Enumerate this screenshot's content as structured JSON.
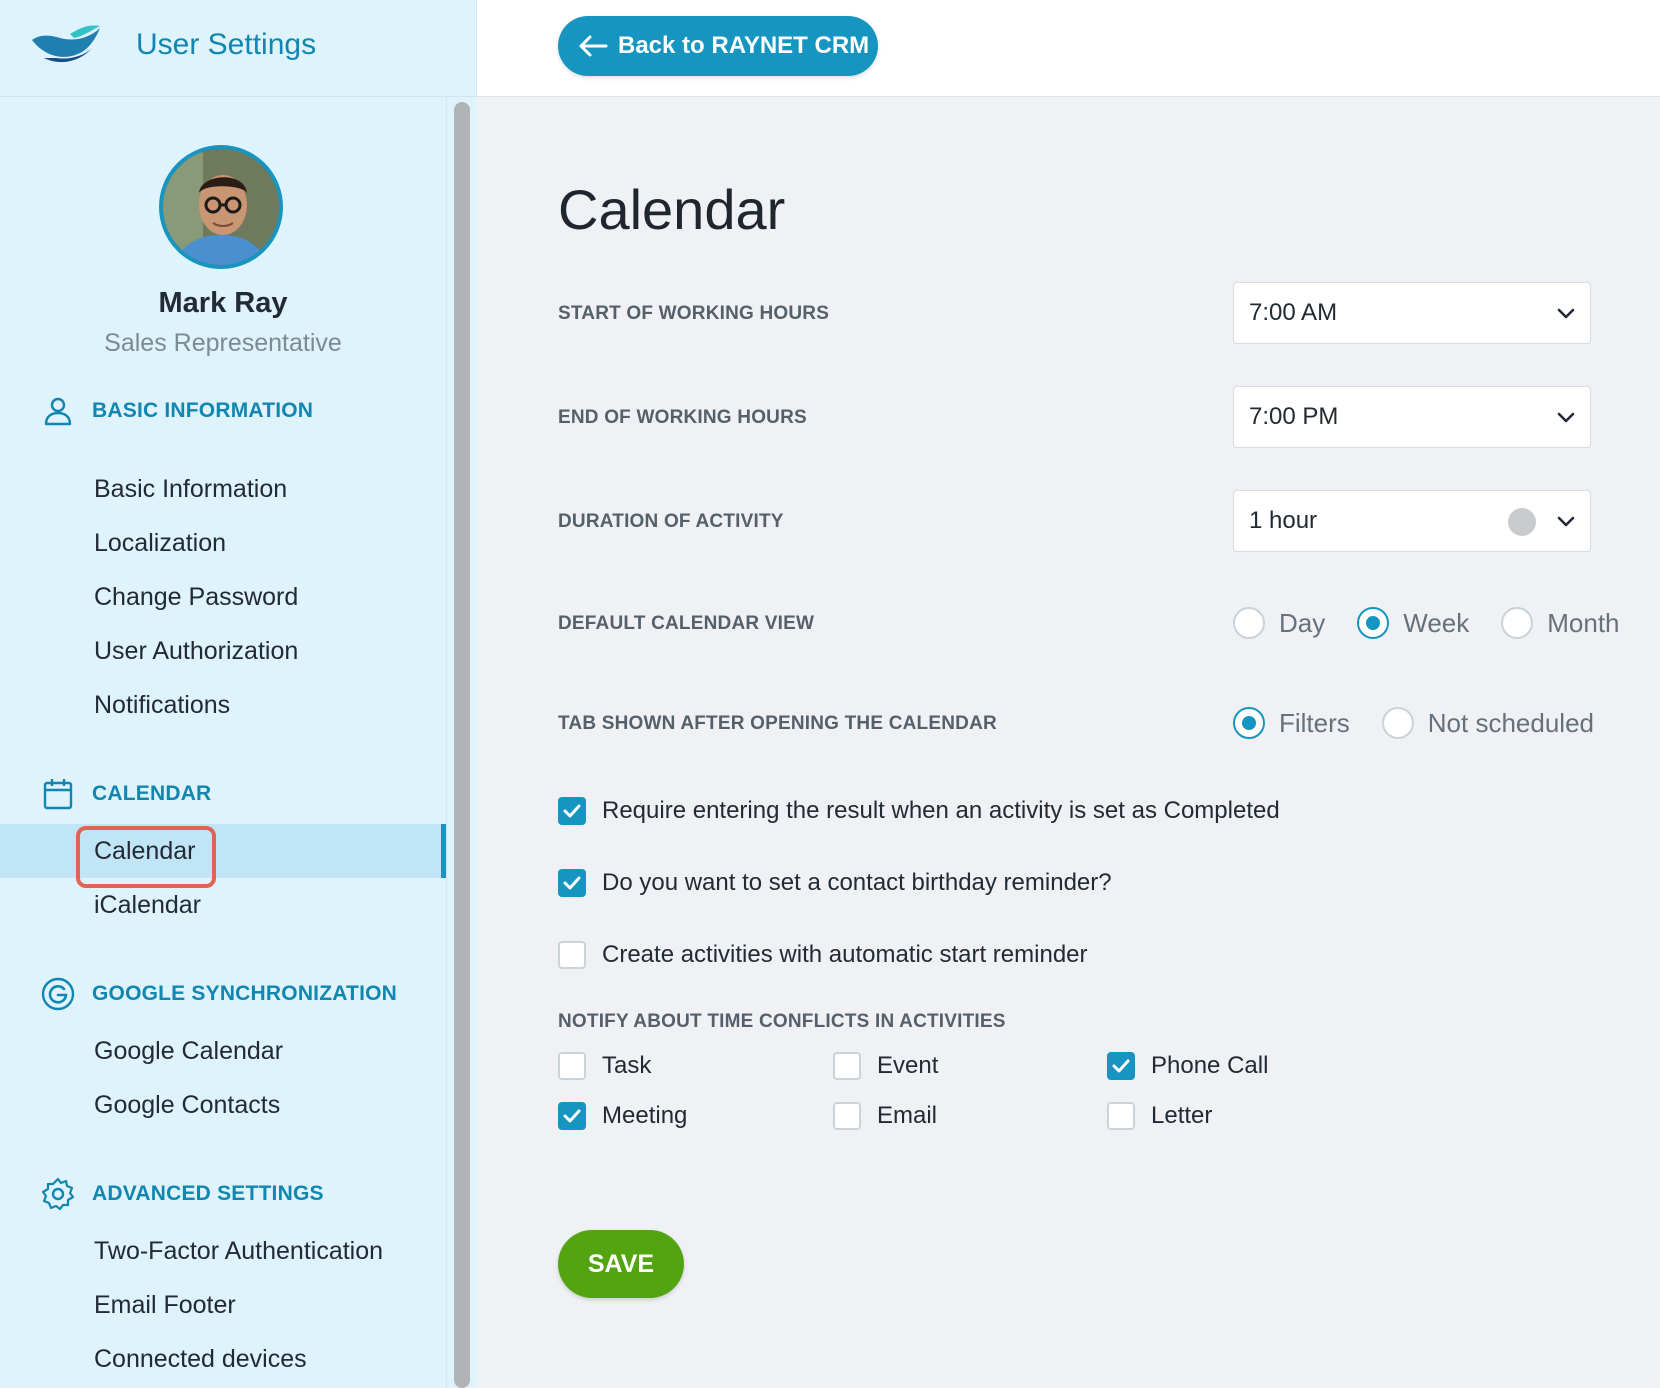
{
  "header": {
    "app_title": "User Settings",
    "back_label": "Back to RAYNET CRM"
  },
  "profile": {
    "name": "Mark Ray",
    "role": "Sales Representative"
  },
  "sidebar": {
    "sections": [
      {
        "title": "BASIC INFORMATION",
        "icon": "person-icon",
        "items": [
          "Basic Information",
          "Localization",
          "Change Password",
          "User Authorization",
          "Notifications"
        ]
      },
      {
        "title": "CALENDAR",
        "icon": "calendar-icon",
        "items": [
          "Calendar",
          "iCalendar"
        ]
      },
      {
        "title": "GOOGLE SYNCHRONIZATION",
        "icon": "google-icon",
        "items": [
          "Google Calendar",
          "Google Contacts"
        ]
      },
      {
        "title": "ADVANCED SETTINGS",
        "icon": "gear-icon",
        "items": [
          "Two-Factor Authentication",
          "Email Footer",
          "Connected devices"
        ]
      }
    ],
    "active_item": "Calendar"
  },
  "main": {
    "title": "Calendar",
    "start_hours": {
      "label": "START OF WORKING HOURS",
      "value": "7:00 AM"
    },
    "end_hours": {
      "label": "END OF WORKING HOURS",
      "value": "7:00 PM"
    },
    "duration": {
      "label": "DURATION OF ACTIVITY",
      "value": "1 hour"
    },
    "default_view": {
      "label": "DEFAULT CALENDAR VIEW",
      "options": [
        "Day",
        "Week",
        "Month"
      ],
      "selected": "Week"
    },
    "tab_shown": {
      "label": "TAB SHOWN AFTER OPENING THE CALENDAR",
      "options": [
        "Filters",
        "Not scheduled"
      ],
      "selected": "Filters"
    },
    "checks": [
      {
        "label": "Require entering the result when an activity is set as Completed",
        "checked": true
      },
      {
        "label": "Do you want to set a contact birthday reminder?",
        "checked": true
      },
      {
        "label": "Create activities with automatic start reminder",
        "checked": false
      }
    ],
    "conflicts": {
      "label": "NOTIFY ABOUT TIME CONFLICTS IN ACTIVITIES",
      "items": [
        {
          "label": "Task",
          "checked": false
        },
        {
          "label": "Event",
          "checked": false
        },
        {
          "label": "Phone Call",
          "checked": true
        },
        {
          "label": "Meeting",
          "checked": true
        },
        {
          "label": "Email",
          "checked": false
        },
        {
          "label": "Letter",
          "checked": false
        }
      ]
    },
    "save_label": "SAVE"
  },
  "colors": {
    "accent": "#1695c1",
    "sidebar_bg": "#dff3fc",
    "save_green": "#52a411",
    "highlight": "#e06452"
  }
}
